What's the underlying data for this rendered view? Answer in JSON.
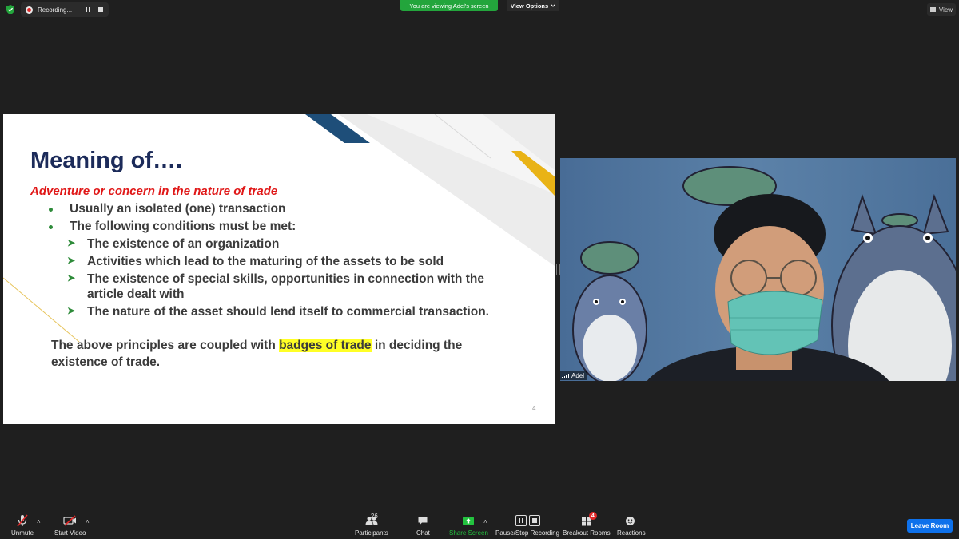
{
  "top_bar": {
    "recording_label": "Recording...",
    "viewing_banner": "You are viewing Adel's screen",
    "view_options_label": "View Options",
    "view_button_label": "View"
  },
  "slide": {
    "title": "Meaning of….",
    "subtitle": "Adventure or concern in the nature of trade",
    "bullets": [
      "Usually an isolated (one) transaction",
      "The following conditions must be met:"
    ],
    "sub_bullets": [
      "The existence of an organization",
      "Activities which lead to the maturing of the assets to be sold",
      "The existence of special skills, opportunities in connection with the",
      "The nature of the asset should lend itself to commercial transaction."
    ],
    "sub_bullet_3_cont": "article dealt with",
    "para_before": "The above principles are coupled with ",
    "para_highlight": "badges of trade",
    "para_after": " in deciding the",
    "para_line2": "existence of trade.",
    "page_number": "4"
  },
  "video": {
    "participant_name": "Adel"
  },
  "toolbar": {
    "unmute_label": "Unmute",
    "start_video_label": "Start Video",
    "participants_label": "Participants",
    "participants_count": "26",
    "chat_label": "Chat",
    "share_screen_label": "Share Screen",
    "recording_label": "Pause/Stop Recording",
    "breakout_label": "Breakout Rooms",
    "breakout_badge": "4",
    "reactions_label": "Reactions",
    "leave_label": "Leave Room"
  },
  "colors": {
    "zoom_green": "#23a53c",
    "leave_blue": "#0e71eb",
    "slide_title": "#1c2b5a",
    "slide_subtitle": "#e01818",
    "bullet_green": "#2e8b3a",
    "highlight": "#ffff26"
  }
}
